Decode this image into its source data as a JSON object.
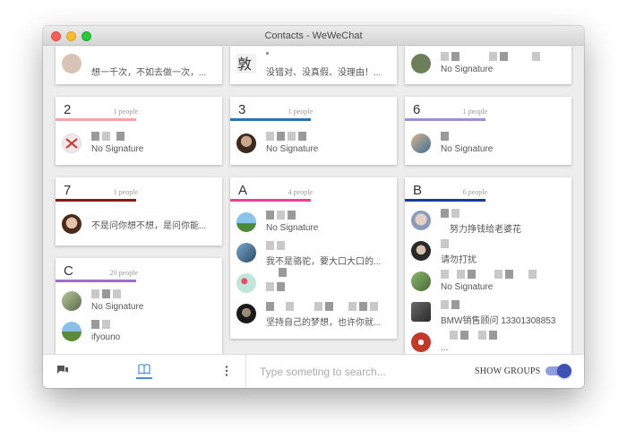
{
  "window": {
    "title": "Contacts - WeWeChat"
  },
  "top_row": [
    {
      "signature": "想一千次，不如去做一次，...",
      "avatar_color": "#d8c3b8"
    },
    {
      "signature": "没错对、没真假、没理由！...",
      "avatar_color": "#f0f0f0"
    },
    {
      "signature": "No Signature",
      "avatar_color": "#6a7f5a"
    }
  ],
  "groups": [
    {
      "letter": "2",
      "count": "1 people",
      "bar_color": "#f4a5a5",
      "entries": [
        {
          "signature": "No Signature",
          "avatar_color": "#c0392b"
        }
      ]
    },
    {
      "letter": "3",
      "count": "1 people",
      "bar_color": "#2c72b0",
      "entries": [
        {
          "signature": "No Signature",
          "avatar_color": "#5a3a2a"
        }
      ]
    },
    {
      "letter": "6",
      "count": "1 people",
      "bar_color": "#9c8fd8",
      "entries": [
        {
          "signature": "No Signature",
          "avatar_color": "#3d6f9a"
        }
      ]
    },
    {
      "letter": "7",
      "count": "1 people",
      "bar_color": "#8b1a1a",
      "entries": [
        {
          "signature": "不是问你想不想，是问你能...",
          "avatar_color": "#6b4a3a"
        }
      ]
    },
    {
      "letter": "A",
      "count": "4 people",
      "bar_color": "#e84393",
      "entries": [
        {
          "signature": "No Signature",
          "avatar_color": "#5fa1c9"
        },
        {
          "signature": "我不是骆驼，要大口大口的...",
          "avatar_color": "#4a6a8a"
        },
        {
          "signature": "",
          "avatar_color": "#a9d8c8"
        },
        {
          "signature": "坚持自己的梦想，也许你就...",
          "avatar_color": "#2a2a2a"
        }
      ]
    },
    {
      "letter": "B",
      "count": "6 people",
      "bar_color": "#1a3a9a",
      "entries": [
        {
          "signature": "努力挣钱给老婆花",
          "avatar_color": "#8a9ab8"
        },
        {
          "signature": "请勿打扰",
          "avatar_color": "#3a3a3a"
        },
        {
          "signature": "No Signature",
          "avatar_color": "#6a8a4a"
        },
        {
          "signature": "BMW销售顾问 13301308853",
          "avatar_color": "#4a4a4a"
        },
        {
          "signature": "...",
          "avatar_color": "#c0392b"
        }
      ]
    },
    {
      "letter": "C",
      "count": "20 people",
      "bar_color": "#9c6bd8",
      "entries": [
        {
          "signature": "No Signature",
          "avatar_color": "#7a8a6a"
        },
        {
          "signature": "ifyouno",
          "avatar_color": "#6a9ac8"
        }
      ]
    }
  ],
  "bottombar": {
    "search_placeholder": "Type someting to search...",
    "show_groups_label": "SHOW GROUPS",
    "accent": "#3f51b5"
  }
}
